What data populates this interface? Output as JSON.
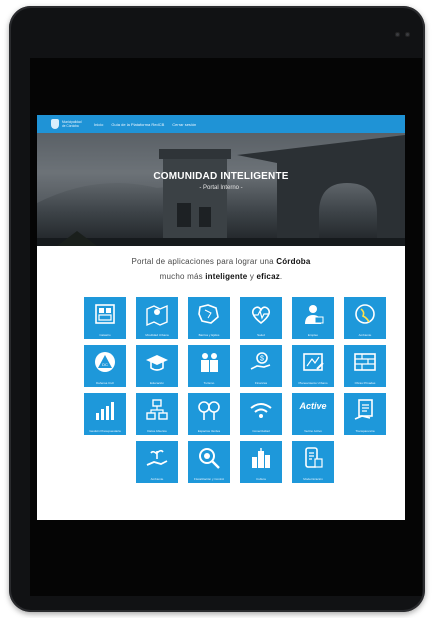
{
  "nav": {
    "brand": "Municipalidad de Córdoba",
    "links": [
      "Inicio",
      "Guía de la Plataforma RedCB",
      "Cerrar sesión"
    ]
  },
  "hero": {
    "title": "COMUNIDAD INTELIGENTE",
    "subtitle": "- Portal Interno -"
  },
  "intro": {
    "line1_a": "Portal de aplicaciones para lograr una ",
    "line1_b": "Córdoba",
    "line2_a": "mucho más ",
    "line2_b": "inteligente",
    "line2_c": " y ",
    "line2_d": "eficaz",
    "line2_e": "."
  },
  "apps": [
    [
      {
        "label": "Catastro",
        "icon": "building-blocks-icon"
      },
      {
        "label": "Movilidad Urbana",
        "icon": "map-pin-icon"
      },
      {
        "label": "Barrios y Ejidos",
        "icon": "territory-map-icon"
      },
      {
        "label": "Salud",
        "icon": "heartbeat-icon"
      },
      {
        "label": "Empleo",
        "icon": "worker-icon"
      },
      {
        "label": "Ambiente",
        "icon": "globe-icon"
      }
    ],
    [
      {
        "label": "Defensa Civil",
        "icon": "warning-triangle-icon"
      },
      {
        "label": "Educación",
        "icon": "graduation-cap-icon"
      },
      {
        "label": "Turismo",
        "icon": "tourist-icon"
      },
      {
        "label": "Finanzas",
        "icon": "money-hand-icon"
      },
      {
        "label": "Planeamiento Urbano",
        "icon": "blueprint-icon"
      },
      {
        "label": "Obras Privadas",
        "icon": "brick-wall-icon"
      }
    ],
    [
      {
        "label": "Gestión Presupuestaria",
        "icon": "bar-growth-icon"
      },
      {
        "label": "Datos Abiertos",
        "icon": "data-tree-icon"
      },
      {
        "label": "Espacios Verdes",
        "icon": "trees-icon"
      },
      {
        "label": "Conectividad",
        "icon": "wifi-icon"
      },
      {
        "label": "Vecino Activo",
        "icon": "active-logo-icon",
        "text": "Active"
      },
      {
        "label": "Transparencia",
        "icon": "document-hand-icon"
      }
    ],
    [
      {
        "label": "Ambiente",
        "icon": "plant-hand-icon"
      },
      {
        "label": "Fiscalización y Control",
        "icon": "magnifier-icon"
      },
      {
        "label": "Cultura",
        "icon": "city-icon"
      },
      {
        "label": "Modernización",
        "icon": "mobile-doc-icon"
      }
    ]
  ]
}
